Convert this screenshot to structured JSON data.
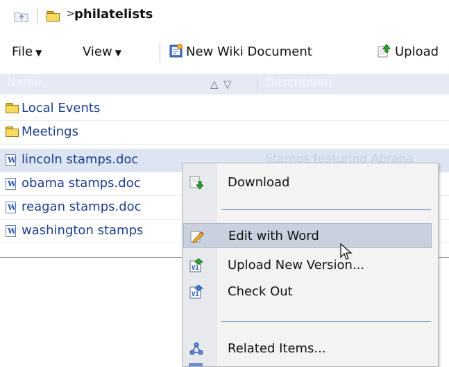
{
  "breadcrumb": {
    "separator": ">",
    "current_folder": "philatelists"
  },
  "toolbar": {
    "file_label": "File",
    "view_label": "View",
    "dropdown_caret": "▼",
    "new_wiki_label": "New Wiki Document",
    "upload_label": "Upload"
  },
  "columns": {
    "name": "Name",
    "description": "Description",
    "sort_asc": "△",
    "sort_desc": "▽"
  },
  "items": [
    {
      "type": "folder",
      "name": "Local Events",
      "description": ""
    },
    {
      "type": "folder",
      "name": "Meetings",
      "description": ""
    },
    {
      "type": "doc",
      "name": "lincoln stamps.doc",
      "description": "Stamps featuring Abraha",
      "selected": true
    },
    {
      "type": "doc",
      "name": "obama stamps.doc",
      "description": ""
    },
    {
      "type": "doc",
      "name": "reagan stamps.doc",
      "description": ""
    },
    {
      "type": "doc",
      "name": "washington stamps",
      "description": ""
    }
  ],
  "context_menu": {
    "items": [
      {
        "label": "Download",
        "icon": "download-icon"
      },
      {
        "label": "Edit with Word",
        "icon": "edit-pencil-icon",
        "highlighted": true
      },
      {
        "label": "Upload New Version...",
        "icon": "version-upload-icon"
      },
      {
        "label": "Check Out",
        "icon": "check-out-icon"
      },
      {
        "label": "Related Items...",
        "icon": "related-items-icon"
      }
    ]
  },
  "colors": {
    "selection": "#dde5f3",
    "menu_highlight": "#c9d1df",
    "link_text": "#1c3f8c"
  }
}
